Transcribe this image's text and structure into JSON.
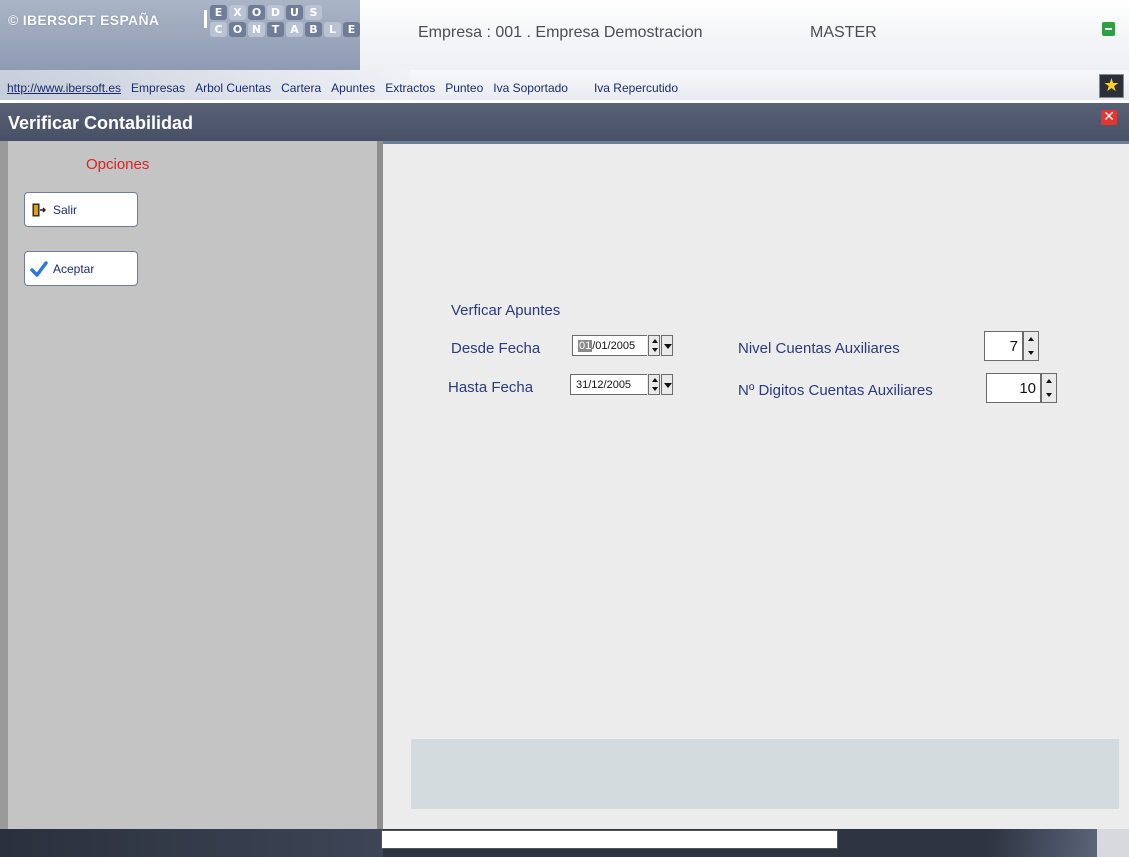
{
  "header": {
    "brand": "© IBERSOFT ESPAÑA",
    "product_top": [
      "E",
      "X",
      "O",
      "D",
      "U",
      "S"
    ],
    "product_bottom": [
      "C",
      "O",
      "N",
      "T",
      "A",
      "B",
      "L",
      "E"
    ],
    "empresa": "Empresa : 001 . Empresa Demostracion",
    "user": "MASTER"
  },
  "menu": {
    "items": [
      "http://www.ibersoft.es",
      "Empresas",
      "Arbol Cuentas",
      "Cartera",
      "Apuntes",
      "Extractos",
      "Punteo",
      "Iva Soportado",
      "Iva Repercutido"
    ]
  },
  "window": {
    "title": "Verificar Contabilidad",
    "close_icon": "close-icon"
  },
  "sidebar": {
    "heading": "Opciones",
    "buttons": {
      "salir": "Salir",
      "aceptar": "Aceptar"
    }
  },
  "form": {
    "section_title": "Verficar Apuntes",
    "desde_label": "Desde Fecha",
    "desde_day": "01",
    "desde_rest": "/01/2005",
    "hasta_label": "Hasta Fecha",
    "hasta_value": "31/12/2005",
    "nivel_label": "Nivel Cuentas Auxiliares",
    "nivel_value": "7",
    "digitos_label": "Nº Digitos Cuentas Auxiliares",
    "digitos_value": "10"
  },
  "colors": {
    "accent": "#485065",
    "heading_red": "#e02020",
    "label_blue": "#2b3a7a",
    "sidebar_bg": "#c4c4c4",
    "main_bg": "#ececec"
  }
}
